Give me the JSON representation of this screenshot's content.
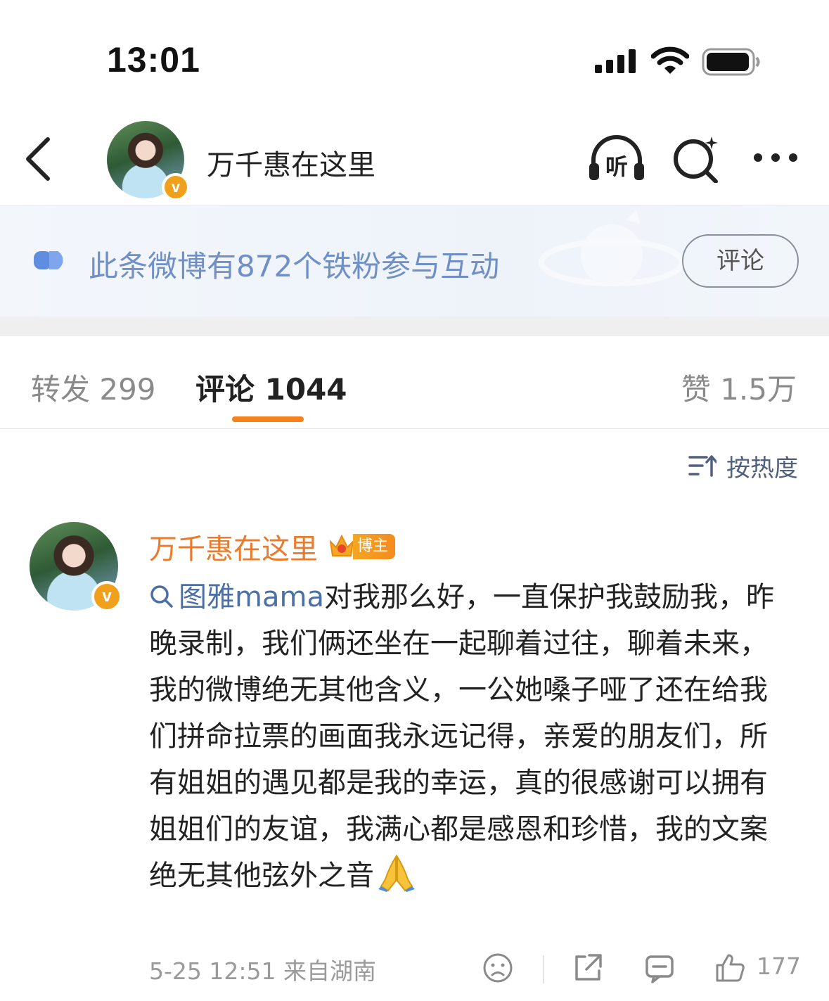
{
  "status_bar": {
    "time": "13:01"
  },
  "header": {
    "title": "万千惠在这里"
  },
  "fan_banner": {
    "text": "此条微博有872个铁粉参与互动",
    "button": "评论"
  },
  "tabs": {
    "repost": "转发 299",
    "comment": "评论 1044",
    "like": "赞 1.5万"
  },
  "sort": {
    "label": "按热度"
  },
  "comment": {
    "author": "万千惠在这里",
    "badge": "博主",
    "topic": "图雅mama",
    "text": "对我那么好，一直保护我鼓励我，昨晚录制，我们俩还坐在一起聊着过往，聊着未来，我的微博绝无其他含义，一公她嗓子哑了还在给我们拼命拉票的画面我永远记得，亲爱的朋友们，所有姐姐的遇见都是我的幸运，真的很感谢可以拥有姐姐们的友谊，我满心都是感恩和珍惜，我的文案绝无其他弦外之音",
    "emoji": "folded-hands",
    "meta": "5-25 12:51 来自湖南",
    "likes": "177"
  },
  "colors": {
    "accent": "#f7811e",
    "author": "#eb7a2a",
    "link": "#4d6fa8",
    "banner_text": "#6f8fc6"
  }
}
